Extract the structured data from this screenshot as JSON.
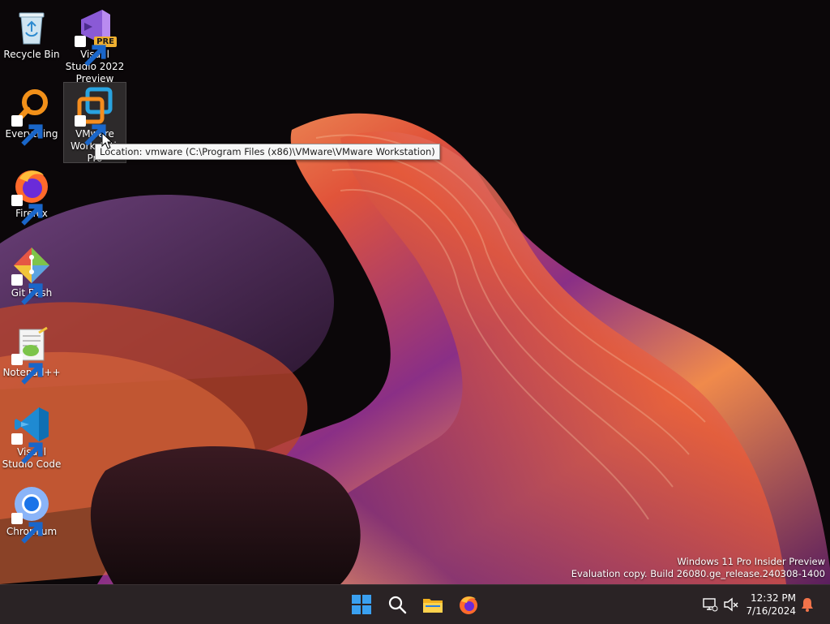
{
  "desktop_icons": [
    {
      "label": "Recycle Bin"
    },
    {
      "label": "Visual Studio 2022 Preview",
      "badge": "PRE"
    },
    {
      "label": "Everything"
    },
    {
      "label": "VMware Workstation Pro"
    },
    {
      "label": "Firefox"
    },
    {
      "label": "Git Bash"
    },
    {
      "label": "Notepad++"
    },
    {
      "label": "Visual Studio Code"
    },
    {
      "label": "Chromium"
    }
  ],
  "tooltip": "Location: vmware (C:\\Program Files (x86)\\VMware\\VMware Workstation)",
  "watermark": {
    "line1": "Windows 11 Pro Insider Preview",
    "line2": "Evaluation copy. Build 26080.ge_release.240308-1400"
  },
  "taskbar": {
    "apps": [
      "start-icon",
      "search-icon",
      "file-explorer-icon",
      "firefox-icon"
    ],
    "tray": [
      "network-icon",
      "volume-muted-icon",
      "notification-bell-icon"
    ],
    "time": "12:32 PM",
    "date": "7/16/2024"
  },
  "colors": {
    "taskbar_bg": "#2a2325",
    "accent_blue": "#0078d4",
    "tooltip_bg": "#f7f7f7"
  }
}
